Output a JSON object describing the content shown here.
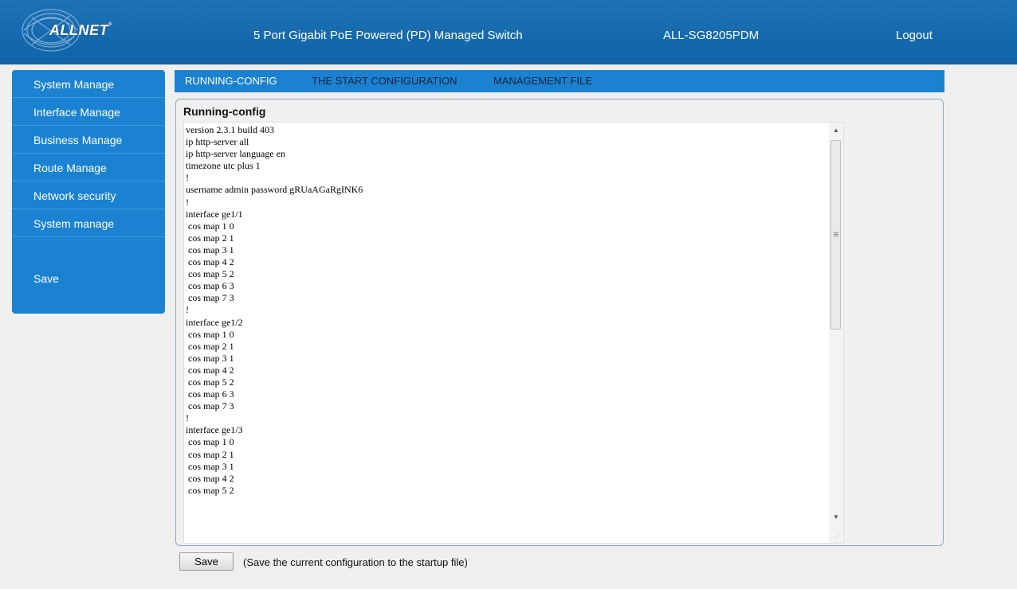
{
  "header": {
    "logo_text": "ALLNET",
    "logo_mark": "®",
    "title": "5 Port Gigabit PoE Powered (PD) Managed Switch",
    "model": "ALL-SG8205PDM",
    "logout": "Logout"
  },
  "sidebar": {
    "items": [
      {
        "label": "System Manage"
      },
      {
        "label": "Interface Manage"
      },
      {
        "label": "Business Manage"
      },
      {
        "label": "Route Manage"
      },
      {
        "label": "Network security"
      },
      {
        "label": "System manage"
      }
    ],
    "save_label": "Save"
  },
  "tabs": [
    {
      "label": "RUNNING-CONFIG"
    },
    {
      "label": "THE START CONFIGURATION"
    },
    {
      "label": "MANAGEMENT FILE"
    }
  ],
  "panel": {
    "title": "Running-config",
    "config_text": "version 2.3.1 build 403\nip http-server all\nip http-server language en\ntimezone utc plus 1\n!\nusername admin password gRUaAGaRgINK6\n!\ninterface ge1/1\n cos map 1 0\n cos map 2 1\n cos map 3 1\n cos map 4 2\n cos map 5 2\n cos map 6 3\n cos map 7 3\n!\ninterface ge1/2\n cos map 1 0\n cos map 2 1\n cos map 3 1\n cos map 4 2\n cos map 5 2\n cos map 6 3\n cos map 7 3\n!\ninterface ge1/3\n cos map 1 0\n cos map 2 1\n cos map 3 1\n cos map 4 2\n cos map 5 2"
  },
  "footer": {
    "save_button": "Save",
    "save_note": "(Save the current configuration to the startup file)"
  },
  "colors": {
    "header_bg": "#1d73b6",
    "sidebar_bg": "#1b82d2",
    "tabbar_bg": "#1b82d2",
    "page_bg": "#efefef"
  }
}
